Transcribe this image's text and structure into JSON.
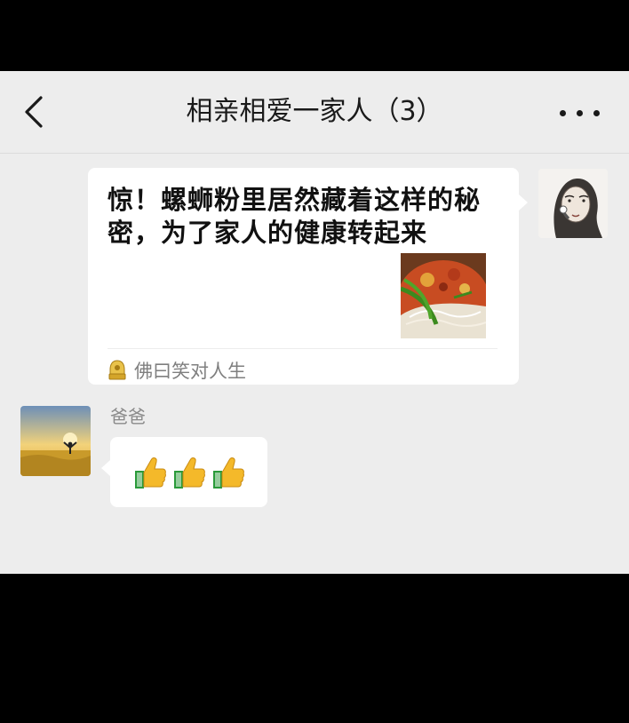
{
  "header": {
    "title": "相亲相爱一家人（3）",
    "back_icon": "chevron-left-icon",
    "more_icon": "more-dots-icon"
  },
  "messages": [
    {
      "sender": "me",
      "type": "link-card",
      "card_title": "惊！螺蛳粉里居然藏着这样的秘密，为了家人的健康转起来",
      "source_icon": "official-account-icon",
      "source_name": "佛曰笑对人生"
    },
    {
      "sender_name": "爸爸",
      "type": "emoji",
      "emoji_names": [
        "thumbs-up",
        "thumbs-up",
        "thumbs-up"
      ]
    }
  ],
  "colors": {
    "background": "#ededed",
    "bubble": "#ffffff",
    "secondary_text": "#7f7f7f"
  }
}
